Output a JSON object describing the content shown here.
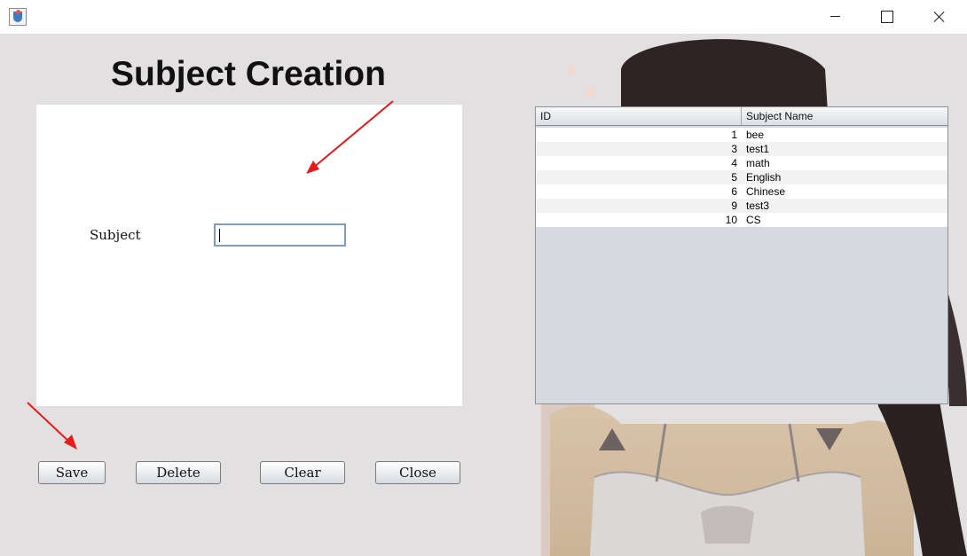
{
  "form": {
    "title": "Subject Creation",
    "subject_label": "Subject",
    "subject_value": ""
  },
  "buttons": {
    "save": "Save",
    "delete": "Delete",
    "clear": "Clear",
    "close": "Close"
  },
  "table": {
    "columns": [
      "ID",
      "Subject Name"
    ],
    "rows": [
      {
        "id": "1",
        "name": "bee"
      },
      {
        "id": "3",
        "name": "test1"
      },
      {
        "id": "4",
        "name": "math"
      },
      {
        "id": "5",
        "name": "English"
      },
      {
        "id": "6",
        "name": "Chinese"
      },
      {
        "id": "9",
        "name": "test3"
      },
      {
        "id": "10",
        "name": "CS"
      }
    ]
  },
  "colors": {
    "client_background": "#e2e0e1",
    "annotation_arrow": "#e51b1b",
    "table_empty_area": "#d6d9e0"
  },
  "icons": [
    "java-app-icon",
    "minimize-icon",
    "maximize-icon",
    "close-icon",
    "annotation-arrow"
  ]
}
